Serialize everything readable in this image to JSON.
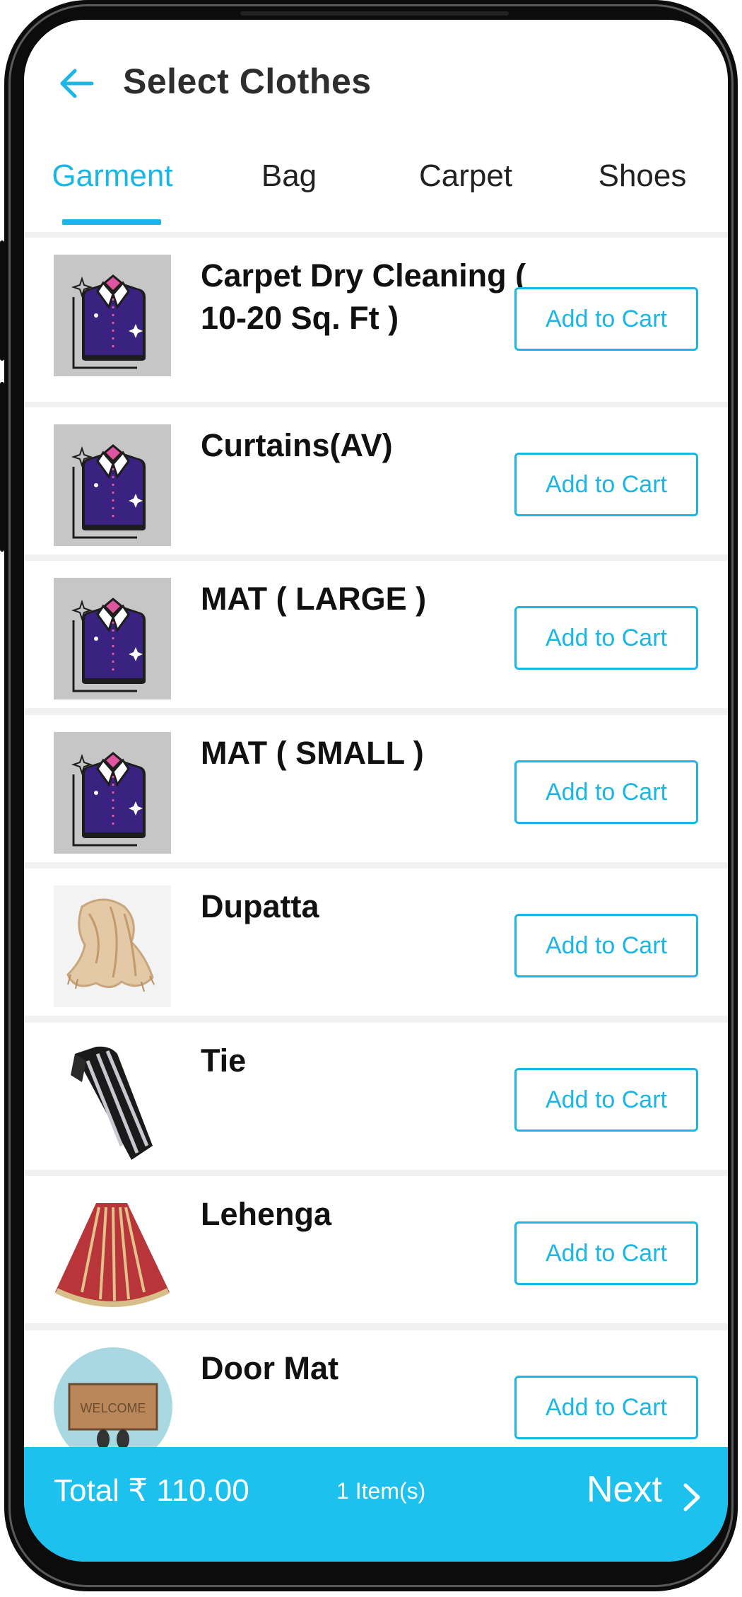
{
  "header": {
    "title": "Select Clothes",
    "back_icon": "arrow-left-icon"
  },
  "tabs": [
    {
      "label": "Garment",
      "active": true
    },
    {
      "label": "Bag",
      "active": false
    },
    {
      "label": "Carpet",
      "active": false
    },
    {
      "label": "Shoes",
      "active": false
    }
  ],
  "items": [
    {
      "name": "Carpet Dry Cleaning ( 10-20 Sq. Ft )",
      "button": "Add to Cart",
      "image": "shirt-icon"
    },
    {
      "name": "Curtains(AV)",
      "button": "Add to Cart",
      "image": "shirt-icon"
    },
    {
      "name": "MAT ( LARGE )",
      "button": "Add to Cart",
      "image": "shirt-icon"
    },
    {
      "name": "MAT ( SMALL )",
      "button": "Add to Cart",
      "image": "shirt-icon"
    },
    {
      "name": "Dupatta",
      "button": "Add to Cart",
      "image": "dupatta-image"
    },
    {
      "name": "Tie",
      "button": "Add to Cart",
      "image": "tie-image"
    },
    {
      "name": "Lehenga",
      "button": "Add to Cart",
      "image": "lehenga-image"
    },
    {
      "name": "Door Mat",
      "button": "Add to Cart",
      "image": "door-mat-image",
      "image_text": "WELCOME"
    }
  ],
  "footer": {
    "total": "Total ₹ 110.00",
    "items_count": "1 Item(s)",
    "next": "Next",
    "next_icon": "chevron-right-icon"
  },
  "colors": {
    "accent": "#1ab7e6",
    "bottom_bar": "#1cc1ee",
    "shirt": "#3a2280",
    "collar": "#e0559f"
  }
}
